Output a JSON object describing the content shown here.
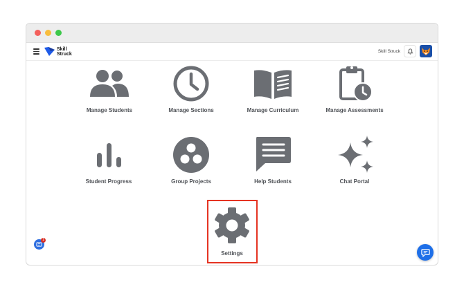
{
  "window": {
    "traffic_lights": {
      "close": "#f4605c",
      "minimize": "#f8bd3e",
      "zoom": "#3dc84a"
    }
  },
  "appbar": {
    "logo_line1": "Skill",
    "logo_line2": "Struck",
    "brand_color": "#1f5be8",
    "user_name": "Skill Struck",
    "icons": {
      "menu": "hamburger-icon",
      "notifications": "bell-icon",
      "avatar": "fox-avatar"
    }
  },
  "tiles": [
    {
      "id": "manage-students",
      "label": "Manage Students",
      "icon": "people-icon"
    },
    {
      "id": "manage-sections",
      "label": "Manage Sections",
      "icon": "clock-icon"
    },
    {
      "id": "manage-curriculum",
      "label": "Manage Curriculum",
      "icon": "open-book-icon"
    },
    {
      "id": "manage-assessments",
      "label": "Manage Assessments",
      "icon": "clipboard-clock-icon"
    },
    {
      "id": "student-progress",
      "label": "Student Progress",
      "icon": "bar-chart-icon"
    },
    {
      "id": "group-projects",
      "label": "Group Projects",
      "icon": "group-circle-icon"
    },
    {
      "id": "help-students",
      "label": "Help Students",
      "icon": "chat-bubble-icon"
    },
    {
      "id": "chat-portal",
      "label": "Chat Portal",
      "icon": "sparkles-icon"
    },
    {
      "id": "settings",
      "label": "Settings",
      "icon": "gear-icon"
    }
  ],
  "icon_color": "#6b6e73",
  "highlight_color": "#e53322",
  "help_badge": {
    "count": "1",
    "icon": "help-badge-icon"
  },
  "chat_fab": {
    "icon": "chat-icon",
    "color": "#1e6fe8"
  }
}
